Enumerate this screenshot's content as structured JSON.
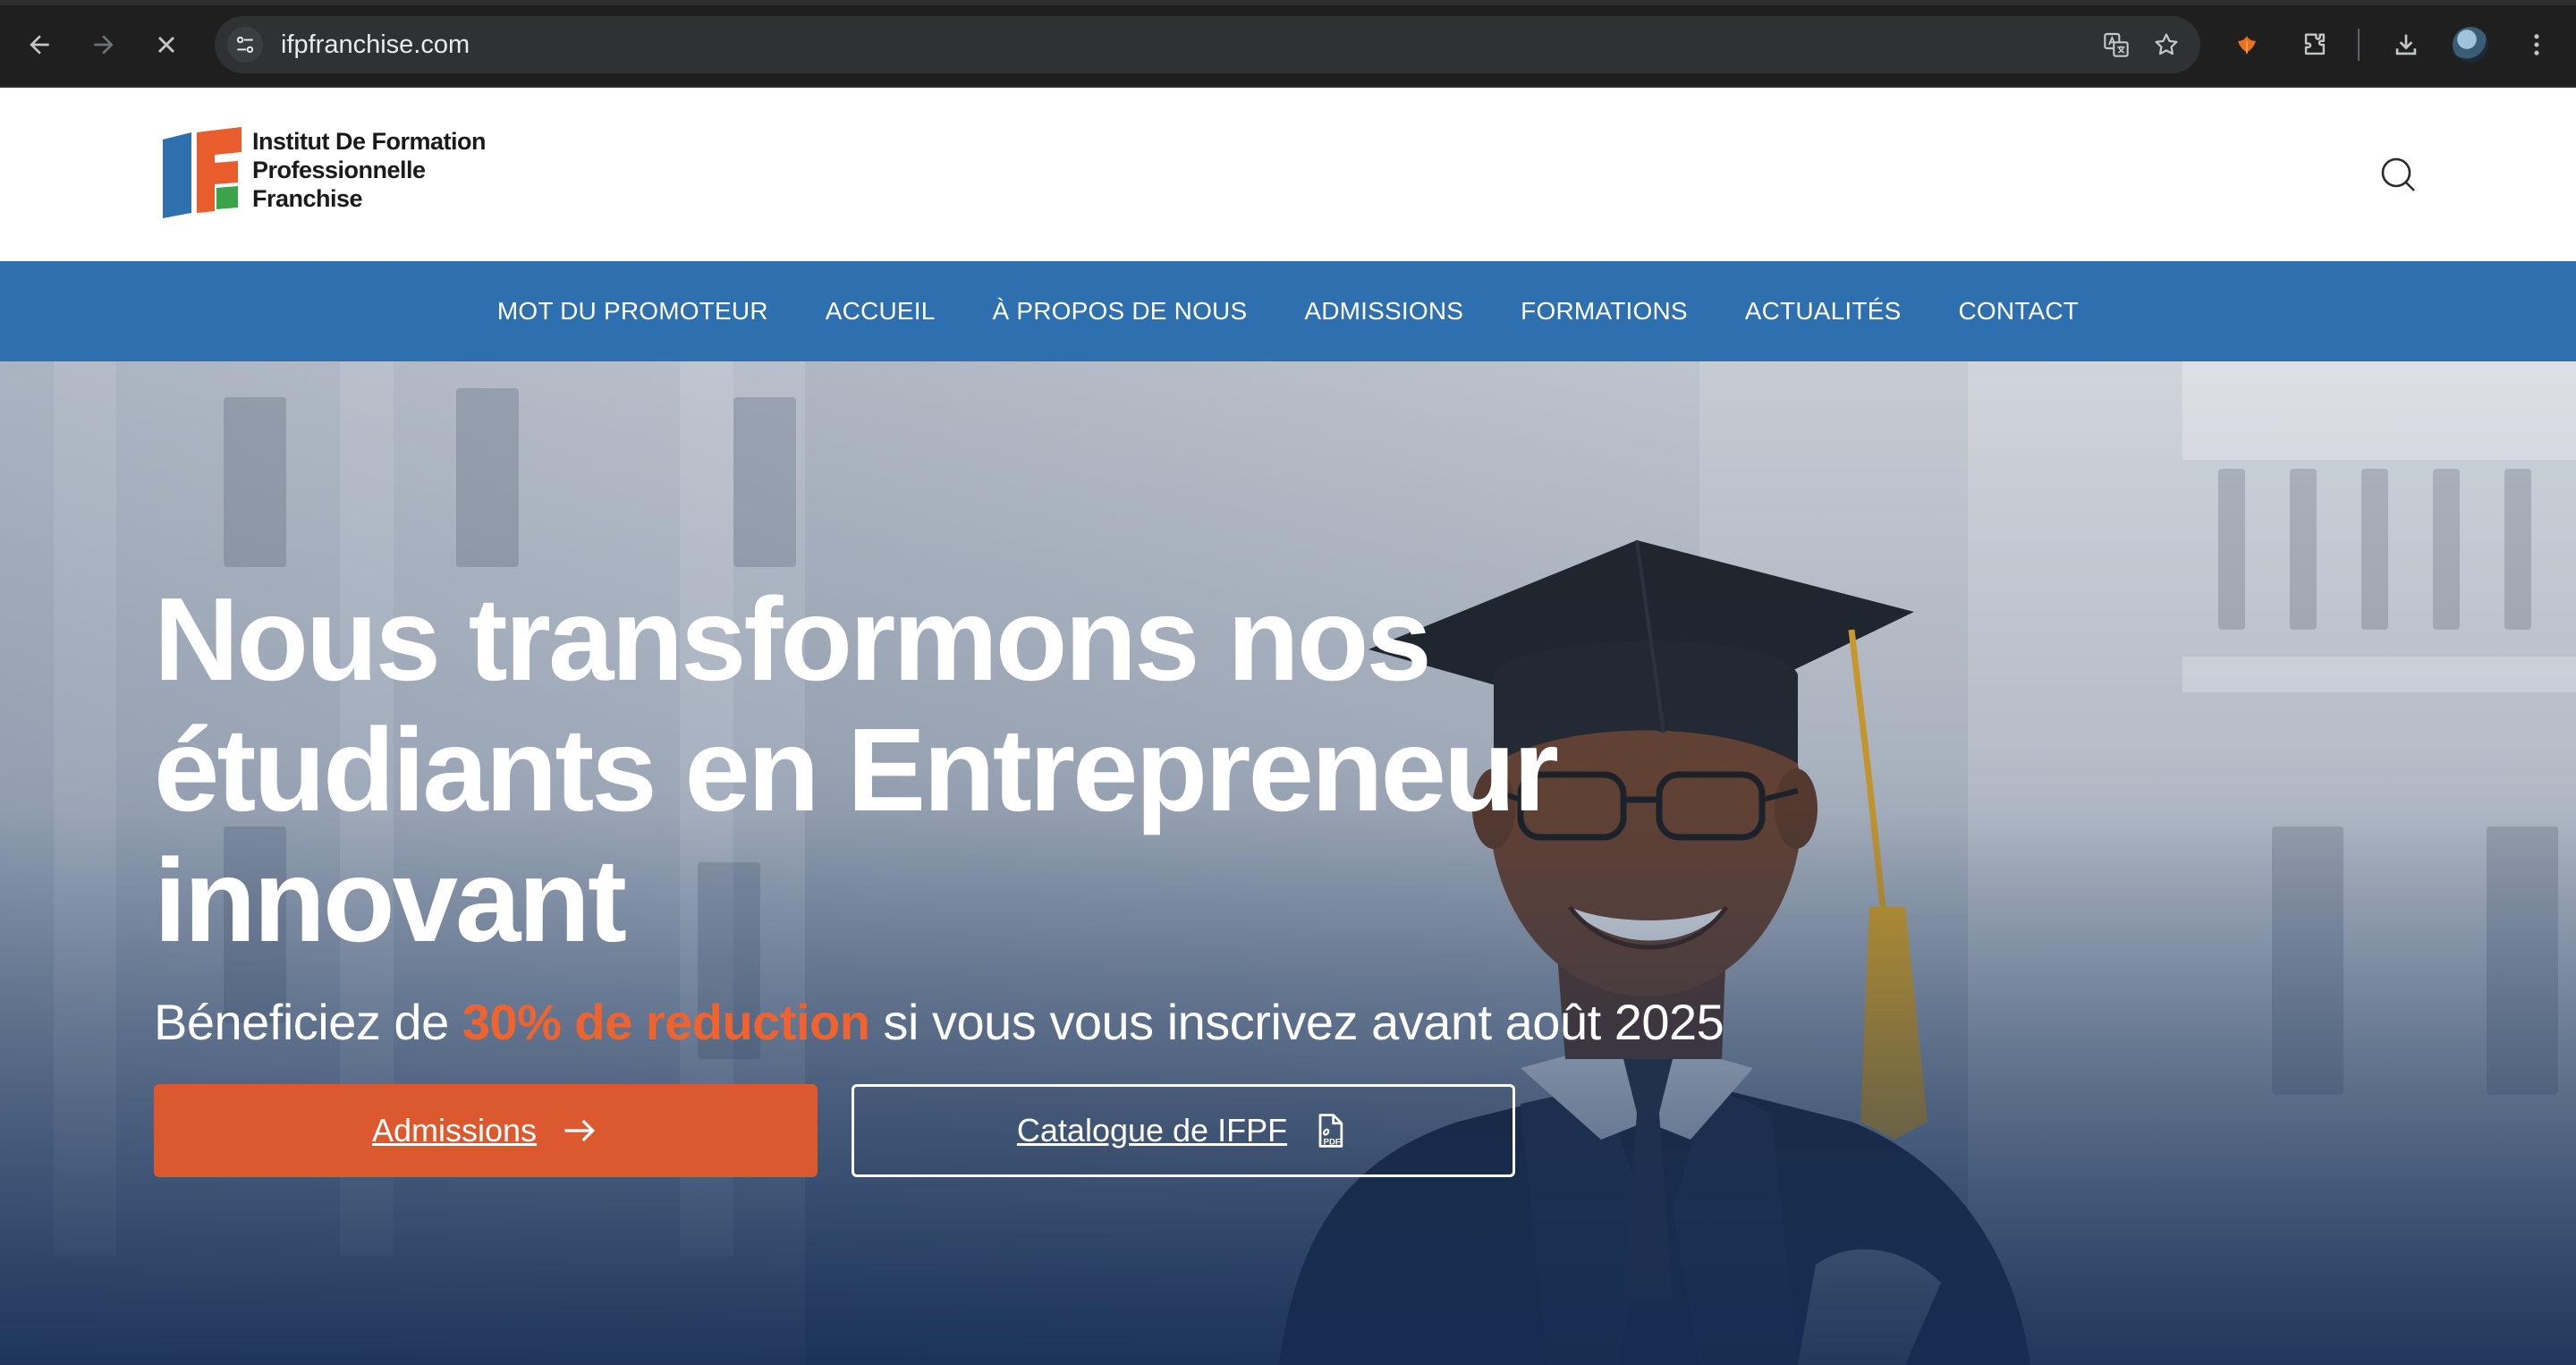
{
  "browser": {
    "url": "ifpfranchise.com",
    "icons": [
      "back-icon",
      "forward-icon",
      "stop-loading-icon",
      "site-info-icon",
      "translate-icon",
      "bookmark-star-icon",
      "extension-icon",
      "puzzle-icon",
      "download-icon",
      "avatar",
      "more-vert-icon"
    ]
  },
  "header": {
    "logo_lines": [
      "Institut De Formation",
      "Professionnelle",
      "Franchise"
    ],
    "logo_colors": {
      "blue": "#2e6fb0",
      "orange": "#e85d2b",
      "green": "#3aa548"
    }
  },
  "nav": {
    "items": [
      "MOT DU PROMOTEUR",
      "ACCUEIL",
      "À PROPOS DE NOUS",
      "ADMISSIONS",
      "FORMATIONS",
      "ACTUALITÉS",
      "CONTACT"
    ],
    "background": "#2e6fb0"
  },
  "hero": {
    "title_lines": [
      "Nous transformons nos",
      "étudiants en Entrepreneur",
      "innovant"
    ],
    "subtitle_before": "Béneficiez de ",
    "subtitle_highlight": "30% de reduction",
    "subtitle_after": " si vous vous inscrivez avant août 2025",
    "primary_button": "Admissions",
    "secondary_button": "Catalogue de IFPF",
    "accent": "#dc582e"
  }
}
